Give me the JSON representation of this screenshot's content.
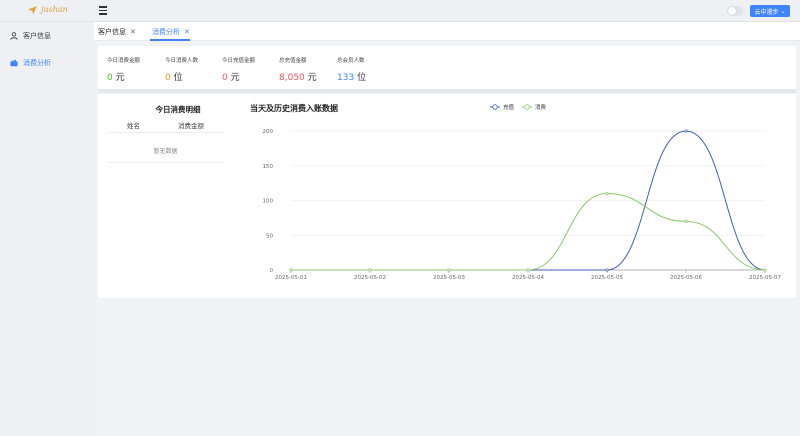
{
  "app": {
    "logo_text": "jushan",
    "user_button": "云中漫步"
  },
  "sidebar": {
    "items": [
      {
        "label": "客户信息",
        "icon": "user-icon"
      },
      {
        "label": "消费分析",
        "icon": "wallet-icon"
      }
    ]
  },
  "tabs": [
    {
      "label": "客户信息"
    },
    {
      "label": "消费分析"
    }
  ],
  "stats": [
    {
      "label": "今日消费金额",
      "value": "0",
      "unit": "元",
      "color": "#52c41a"
    },
    {
      "label": "今日消费人数",
      "value": "0",
      "unit": "位",
      "color": "#d99a1e"
    },
    {
      "label": "今日充值金额",
      "value": "0",
      "unit": "元",
      "color": "#f5515f"
    },
    {
      "label": "总充值金额",
      "value": "8,050",
      "unit": "元",
      "color": "#f5515f"
    },
    {
      "label": "总会员人数",
      "value": "133",
      "unit": "位",
      "color": "#3f84ff"
    }
  ],
  "table": {
    "title": "今日消费明细",
    "columns": [
      "姓名",
      "消费金额"
    ],
    "empty_text": "暂无数据"
  },
  "chart_data": {
    "type": "line",
    "title": "当天及历史消费入账数据",
    "x": [
      "2025-05-01",
      "2025-05-02",
      "2025-05-03",
      "2025-05-04",
      "2025-05-05",
      "2025-05-06",
      "2025-05-07"
    ],
    "series": [
      {
        "name": "充值",
        "values": [
          0,
          0,
          0,
          0,
          0,
          200,
          0
        ],
        "color": "#3b5fb5"
      },
      {
        "name": "消费",
        "values": [
          0,
          0,
          0,
          0,
          110,
          70,
          0
        ],
        "color": "#8cc96b"
      }
    ],
    "ylim": [
      0,
      200
    ],
    "yticks": [
      0,
      50,
      100,
      150,
      200
    ],
    "smooth": true,
    "legend_position": "top-right",
    "grid": true
  }
}
